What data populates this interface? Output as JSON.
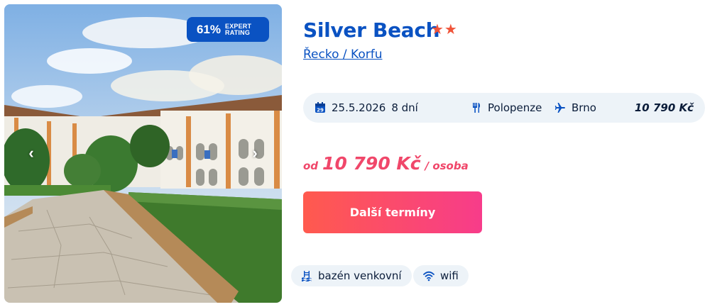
{
  "hotel": {
    "name": "Silver Beach",
    "stars": "★★",
    "location": "Řecko / Korfu"
  },
  "rating": {
    "percent": "61%",
    "label_line1": "EXPERT",
    "label_line2": "RATING"
  },
  "gallery": {
    "prev_glyph": "‹",
    "next_glyph": "›"
  },
  "trip": {
    "date": "25.5.2026",
    "duration": "8 dní",
    "board": "Polopenze",
    "departure": "Brno",
    "price": "10 790 Kč"
  },
  "price": {
    "from": "od",
    "amount": "10 790 Kč",
    "per": "/ osoba"
  },
  "cta": {
    "label": "Další termíny"
  },
  "amenities": [
    {
      "label": "bazén venkovní",
      "icon": "pool-icon"
    },
    {
      "label": "wifi",
      "icon": "wifi-icon"
    }
  ],
  "colors": {
    "brand_blue": "#0a52c2",
    "price_pink": "#f0476a",
    "star_red": "#f0543a",
    "cta_start": "#ff5a4e",
    "cta_end": "#f73c8a",
    "pill_bg": "#edf3f8"
  }
}
